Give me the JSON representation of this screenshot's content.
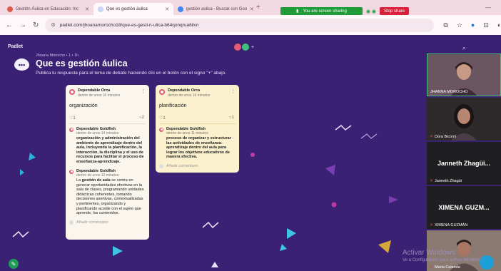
{
  "browser": {
    "tabs": [
      {
        "label": "Gestión Áulica en Educación: Inc",
        "active": false
      },
      {
        "label": "Que es gestión áulica",
        "active": true
      },
      {
        "label": "gestión aulica - Buscar con Goo",
        "active": false
      }
    ],
    "new_tab": "+",
    "sharing_text": "You are screen sharing",
    "stop_share": "Stop share",
    "url": "padlet.com/jhoanamorocho18/que-es-gesti-n-ulica-b64qonqrua6ilvn"
  },
  "padlet": {
    "logo": "Padlet",
    "more_collaborators": "+",
    "breadcrumb": "Jhoana Morocho • 1 • 1h",
    "title": "Que es gestión áulica",
    "description": "Publica tu respuesta para el tema de debate haciendo clic en el botón con el signo \"+\" abajo.",
    "posts": [
      {
        "author": "Dependable Orca",
        "time": "dentro de unos 16 minutos",
        "body": "organización",
        "likes": "1",
        "comment_count": "2",
        "comments": [
          {
            "author": "Dependable Goldfish",
            "time": "dentro de unos 14 minutos",
            "text": "organización y administración del ambiente de aprendizaje dentro del aula, incluyendo la planificación, la interacción, la disciplina y el uso de recursos para facilitar el proceso de enseñanza-aprendizaje."
          },
          {
            "author": "Dependable Goldfish",
            "time": "dentro de unos 12 minutos",
            "lead": "La ",
            "bold": "gestión de aula",
            "text": " se centra en generar oportunidades efectivas en la sala de clases, programando unidades didácticas coherentes, tomando decisiones asertivas, contextualizadas y pertinentes, organizando y planificando acorde con el sujeto que aprende, los contenidos."
          }
        ],
        "add_comment": "Añadir comentario"
      },
      {
        "author": "Dependable Orca",
        "time": "dentro de unos 16 minutos",
        "body": "planificación",
        "likes": "1",
        "comment_count": "1",
        "comments": [
          {
            "author": "Dependable Goldfish",
            "time": "dentro de unos 11 minutos",
            "text": "proceso de organizar y estructurar las actividades de enseñanza-aprendizaje dentro del aula para lograr los objetivos educativos de manera efectiva."
          }
        ],
        "add_comment": "Añadir comentario"
      }
    ]
  },
  "participants": [
    {
      "name": "JHANNA MOROCHO",
      "video": true,
      "bg": "#6b5560"
    },
    {
      "name": "Dora Bicorni",
      "video": true,
      "bg": "#2e2a2c",
      "muted": true
    },
    {
      "name": "Janneth Zhagüi...",
      "label": "Janneth Zhagüi",
      "video": false,
      "muted": true
    },
    {
      "name": "XIMENA GUZM...",
      "label": "XIMENA GUZMÁN",
      "video": false,
      "muted": true
    },
    {
      "name": "Maria Calanda",
      "video": true,
      "bg": "#8a7a72",
      "muted": true
    }
  ],
  "system": {
    "watermark": "Activar Windows",
    "watermark_sub": "Ve a Configuración para activar Windows."
  },
  "colors": {
    "board_bg": "#3a2173",
    "post_bg_1": "#fbf6ed",
    "post_bg_2": "#fbf1cf",
    "accent_avatar": "#e25b70",
    "share_green": "#1f9b37",
    "stop_red": "#d8213a"
  }
}
